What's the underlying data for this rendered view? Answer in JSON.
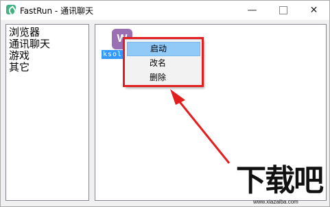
{
  "window": {
    "title": "FastRun - 通讯聊天",
    "minimize": "—",
    "close": "✕"
  },
  "sidebar": {
    "items": [
      {
        "label": "浏览器"
      },
      {
        "label": "通讯聊天"
      },
      {
        "label": "游戏"
      },
      {
        "label": "其它"
      }
    ]
  },
  "content": {
    "app": {
      "icon": "wps-icon",
      "icon_letter": "W",
      "name": "ksola"
    }
  },
  "context_menu": {
    "items": [
      {
        "label": "启动"
      },
      {
        "label": "改名"
      },
      {
        "label": "删除"
      }
    ]
  },
  "watermark": {
    "main": "下载吧",
    "url": "www.xiazaiba.com"
  },
  "colors": {
    "highlight_red": "#e31e1e",
    "selection_blue": "#3399ff",
    "menu_hover": "#91c9f7"
  }
}
